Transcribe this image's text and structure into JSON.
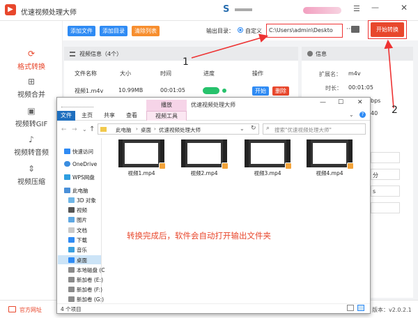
{
  "app": {
    "title": "优速视频处理大师",
    "version": "版本：v2.0.2.1",
    "official_site": "官方网址"
  },
  "sidebar": {
    "items": [
      {
        "label": "格式转换",
        "active": true
      },
      {
        "label": "视频合并"
      },
      {
        "label": "视频转GIF"
      },
      {
        "label": "视频转音频"
      },
      {
        "label": "视频压缩"
      }
    ]
  },
  "toolbar": {
    "add_file": "添加文件",
    "add_dir": "添加目录",
    "clear_list": "清除列表",
    "output_label": "输出目录：",
    "custom_label": "自定义",
    "output_path": "C:\\Users\\admin\\Deskto",
    "more": "···",
    "start_convert": "开始转换"
  },
  "video_panel": {
    "title": "视频信息（4个）",
    "columns": [
      "文件名称",
      "大小",
      "时间",
      "进度",
      "操作"
    ],
    "row": {
      "name": "视频1.m4v",
      "size": "10.99MB",
      "time": "00:01:05",
      "start": "开始",
      "delete": "删除"
    }
  },
  "info_panel": {
    "title": "信息",
    "ext_label": "扩展名：",
    "ext_value": "m4v",
    "duration_label": "时长：",
    "duration_value": "00:01:05",
    "bitrate_partial": "bps",
    "fps_partial": "40",
    "select_a": "分",
    "select_b": "s"
  },
  "annotations": {
    "label1": "1",
    "label2": "2",
    "caption": "转换完成后，软件会自动打开输出文件夹"
  },
  "explorer": {
    "title": "优速视频处理大师",
    "context_tab": "播放",
    "tabs": [
      "文件",
      "主页",
      "共享",
      "查看",
      "视频工具"
    ],
    "breadcrumb": [
      "此电脑",
      "桌面",
      "优速视频处理大师"
    ],
    "search_placeholder": "搜索\"优速视频处理大师\"",
    "nav": [
      "快速访问",
      "OneDrive",
      "WPS网盘",
      "此电脑",
      "3D 对象",
      "视频",
      "图片",
      "文档",
      "下载",
      "音乐",
      "桌面",
      "本地磁盘 (C",
      "新加卷 (E:)",
      "新加卷 (F:)",
      "新加卷 (G:)"
    ],
    "files": [
      "视频1.mp4",
      "视频2.mp4",
      "视频3.mp4",
      "视频4.mp4"
    ],
    "status": "4 个项目"
  },
  "colors": {
    "brand_red": "#e8472c",
    "blue": "#2f8bf4",
    "orange": "#f78e2e",
    "green": "#27c26c",
    "ribbon_blue": "#1e6fbf"
  }
}
